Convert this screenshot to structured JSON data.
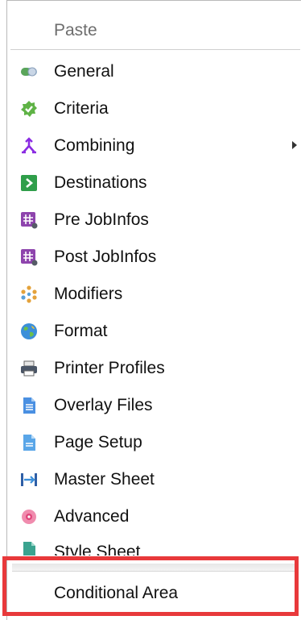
{
  "menu": {
    "paste_label": "Paste",
    "items": [
      {
        "label": "General",
        "icon": "toggle-icon"
      },
      {
        "label": "Criteria",
        "icon": "check-badge-icon"
      },
      {
        "label": "Combining",
        "icon": "merge-arrow-icon"
      },
      {
        "label": "Destinations",
        "icon": "destination-icon"
      },
      {
        "label": "Pre JobInfos",
        "icon": "hash-gear-icon"
      },
      {
        "label": "Post JobInfos",
        "icon": "hash-gear-icon"
      },
      {
        "label": "Modifiers",
        "icon": "modifier-dots-icon"
      },
      {
        "label": "Format",
        "icon": "globe-icon"
      },
      {
        "label": "Printer Profiles",
        "icon": "printer-icon"
      },
      {
        "label": "Overlay Files",
        "icon": "document-icon"
      },
      {
        "label": "Page Setup",
        "icon": "page-icon"
      },
      {
        "label": "Master Sheet",
        "icon": "master-sheet-icon"
      },
      {
        "label": "Advanced",
        "icon": "advanced-gear-icon"
      },
      {
        "label": "Style Sheet",
        "icon": "style-sheet-icon"
      }
    ],
    "conditional_label": "Conditional Area"
  },
  "colors": {
    "highlight": "#e8393b",
    "accent_green": "#3cb44b",
    "accent_purple": "#8a2be2"
  }
}
